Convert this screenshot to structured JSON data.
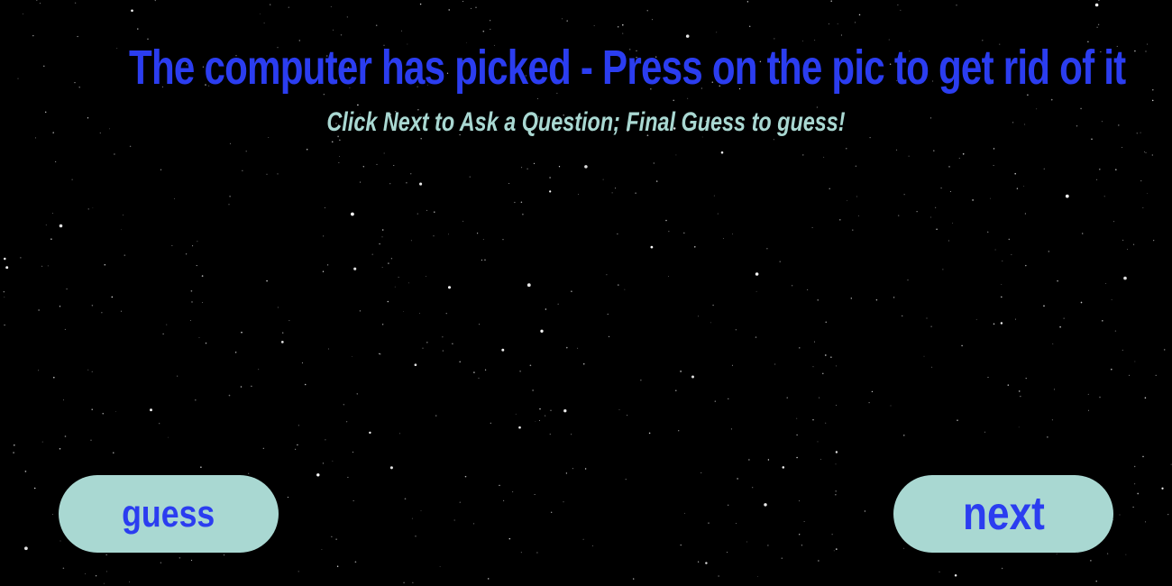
{
  "header": {
    "title": "The computer has picked - Press on the pic to get rid of it",
    "subtitle": "Click Next to Ask a Question; Final Guess to guess!"
  },
  "buttons": {
    "guess_label": "guess",
    "next_label": "next"
  },
  "colors": {
    "background": "#000000",
    "title": "#2b3df0",
    "subtitle": "#a9d8d2",
    "button_fill": "#a9d8d2",
    "button_text": "#2b3df0",
    "stars": "#ffffff"
  }
}
